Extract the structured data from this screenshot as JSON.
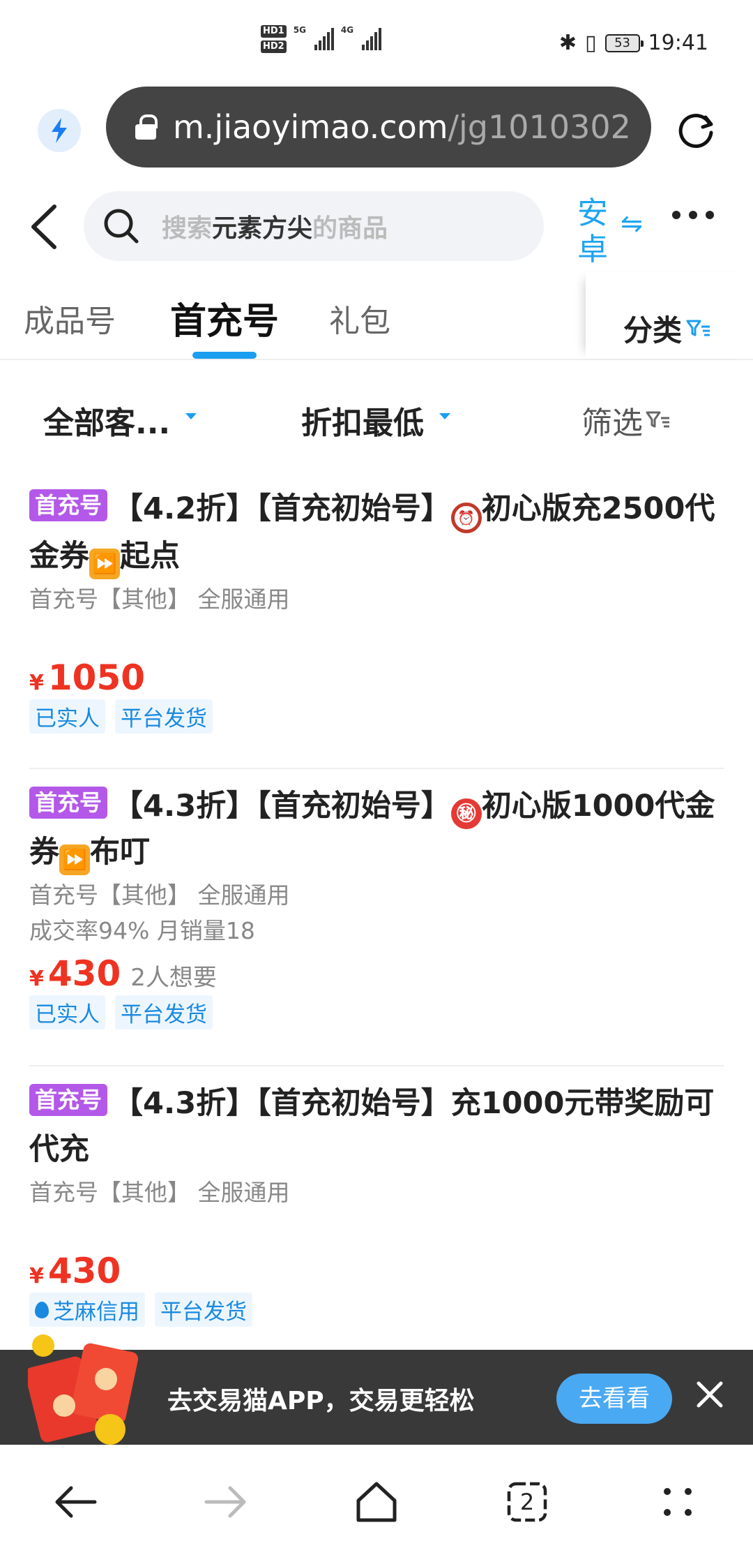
{
  "status_bar": {
    "time": "19:41",
    "battery": "53",
    "net1": "5G",
    "net2": "4G"
  },
  "browser": {
    "url_host": "m.jiaoyimao.com",
    "url_path": "/jg1010302",
    "tab_count": "2"
  },
  "search": {
    "placeholder_prefix": "搜索",
    "placeholder_keyword": "元素方尖",
    "placeholder_suffix": "的商品",
    "platform": "安卓"
  },
  "tabs": [
    {
      "label": "成品号"
    },
    {
      "label": "首充号"
    },
    {
      "label": "礼包"
    }
  ],
  "category_label": "分类",
  "filters": {
    "client": "全部客...",
    "sort": "折扣最低",
    "filter": "筛选"
  },
  "listings": [
    {
      "badge": "首充号",
      "title_a": "【4.2折】【首充初始号】",
      "title_b": "初心版充2500代金券",
      "title_c": "起点",
      "sub": "首充号【其他】 全服通用",
      "stats": "",
      "currency": "¥",
      "price": "1050",
      "want": "",
      "tags": [
        "已实人",
        "平台发货"
      ]
    },
    {
      "badge": "首充号",
      "title_a": "【4.3折】【首充初始号】",
      "title_b": "初心版1000代金券",
      "title_c": "布叮",
      "sub": "首充号【其他】 全服通用",
      "stats": "成交率94% 月销量18",
      "currency": "¥",
      "price": "430",
      "want": "2人想要",
      "tags": [
        "已实人",
        "平台发货"
      ]
    },
    {
      "badge": "首充号",
      "title_a": "【4.3折】【首充初始号】充1000元带奖励可代充",
      "sub": "首充号【其他】 全服通用",
      "currency": "¥",
      "price": "430",
      "tags": [
        "芝麻信用",
        "平台发货"
      ]
    }
  ],
  "promo": {
    "text": "去交易猫APP，交易更轻松",
    "button": "去看看"
  },
  "colors": {
    "accent": "#1a9ef0",
    "price": "#ee3322",
    "badge": "#b358e8"
  }
}
